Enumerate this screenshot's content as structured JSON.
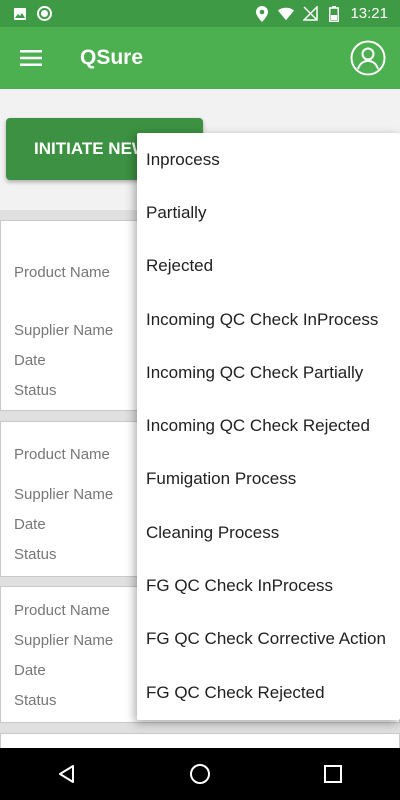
{
  "status_bar": {
    "time": "13:21",
    "icons": [
      "image-icon",
      "record-icon",
      "location-icon",
      "wifi-icon",
      "signal-off-icon",
      "battery-icon"
    ]
  },
  "app_bar": {
    "title": "QSure",
    "menu_icon": "hamburger-menu-icon",
    "profile_icon": "account-circle-icon"
  },
  "main": {
    "initiate_button_label": "INITIATE NEW"
  },
  "cards": [
    {
      "product_label": "Product Name",
      "supplier_label": "Supplier Name",
      "date_label": "Date",
      "status_label": "Status"
    },
    {
      "product_label": "Product Name",
      "supplier_label": "Supplier Name",
      "date_label": "Date",
      "status_label": "Status"
    },
    {
      "product_label": "Product Name",
      "supplier_label": "Supplier Name",
      "date_label": "Date",
      "status_label": "Status"
    }
  ],
  "dropdown": {
    "items": [
      "Inprocess",
      "Partially",
      "Rejected",
      "Incoming QC Check InProcess",
      "Incoming QC Check Partially",
      "Incoming QC Check Rejected",
      "Fumigation Process",
      "Cleaning Process",
      "FG QC Check InProcess",
      "FG QC Check Corrective Action",
      "FG QC Check Rejected"
    ]
  },
  "nav_bar": {
    "icons": [
      "back-icon",
      "home-icon",
      "recents-icon"
    ]
  },
  "colors": {
    "status_bar": "#3f9a45",
    "app_bar": "#4caf50",
    "button": "#3d9142"
  }
}
